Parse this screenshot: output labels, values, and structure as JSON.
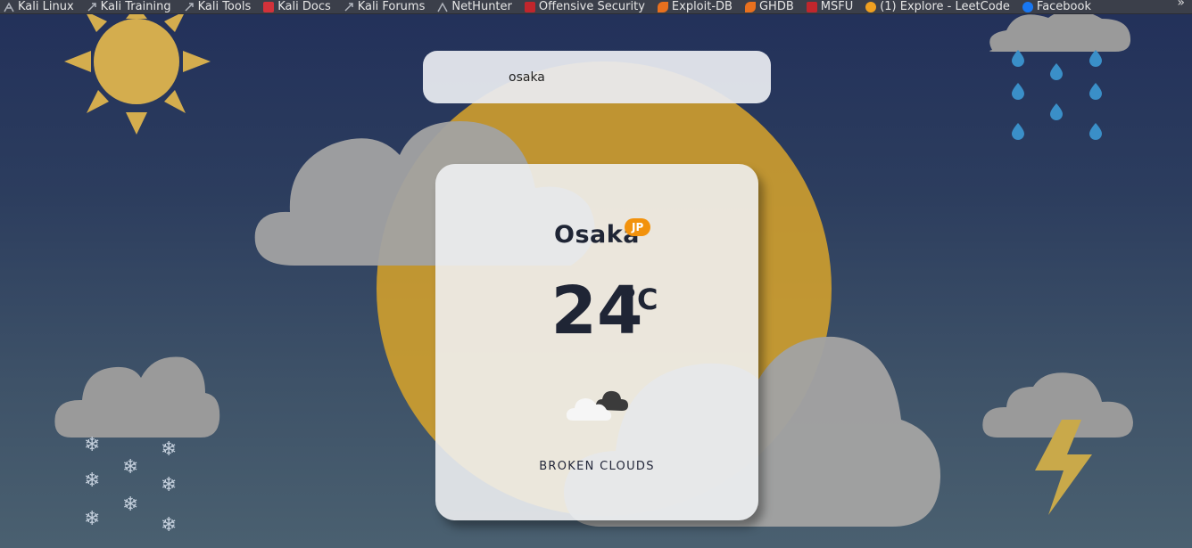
{
  "bookmarks": [
    {
      "label": "Kali Linux",
      "icon": "kali-dragon-icon",
      "color": "#9aa0aa"
    },
    {
      "label": "Kali Training",
      "icon": "kali-dragon-icon",
      "color": "#9aa0aa"
    },
    {
      "label": "Kali Tools",
      "icon": "kali-dragon-icon",
      "color": "#9aa0aa"
    },
    {
      "label": "Kali Docs",
      "icon": "kali-docs-icon",
      "color": "#d2323a"
    },
    {
      "label": "Kali Forums",
      "icon": "kali-dragon-icon",
      "color": "#9aa0aa"
    },
    {
      "label": "NetHunter",
      "icon": "nethunter-icon",
      "color": "#9aa0aa"
    },
    {
      "label": "Offensive Security",
      "icon": "offsec-icon",
      "color": "#c0262c"
    },
    {
      "label": "Exploit-DB",
      "icon": "exploit-db-icon",
      "color": "#e8701e"
    },
    {
      "label": "GHDB",
      "icon": "ghdb-icon",
      "color": "#e8701e"
    },
    {
      "label": "MSFU",
      "icon": "msfu-icon",
      "color": "#c0262c"
    },
    {
      "label": "(1) Explore - LeetCode",
      "icon": "leetcode-icon",
      "color": "#f0a020"
    },
    {
      "label": "Facebook",
      "icon": "facebook-icon",
      "color": "#1877f2"
    }
  ],
  "bookmarks_overflow_icon": "chevron-double-right-icon",
  "search": {
    "value": "osaka"
  },
  "weather": {
    "city": "Osaka",
    "country": "JP",
    "temperature": "24",
    "unit": "°C",
    "description": "BROKEN CLOUDS",
    "icon": "broken-clouds-icon"
  },
  "colors": {
    "accent": "#f2920c",
    "text": "#1f2535",
    "sun": "#e0b230",
    "cloud": "#a0a0a0",
    "rain": "#3a8fc8"
  }
}
